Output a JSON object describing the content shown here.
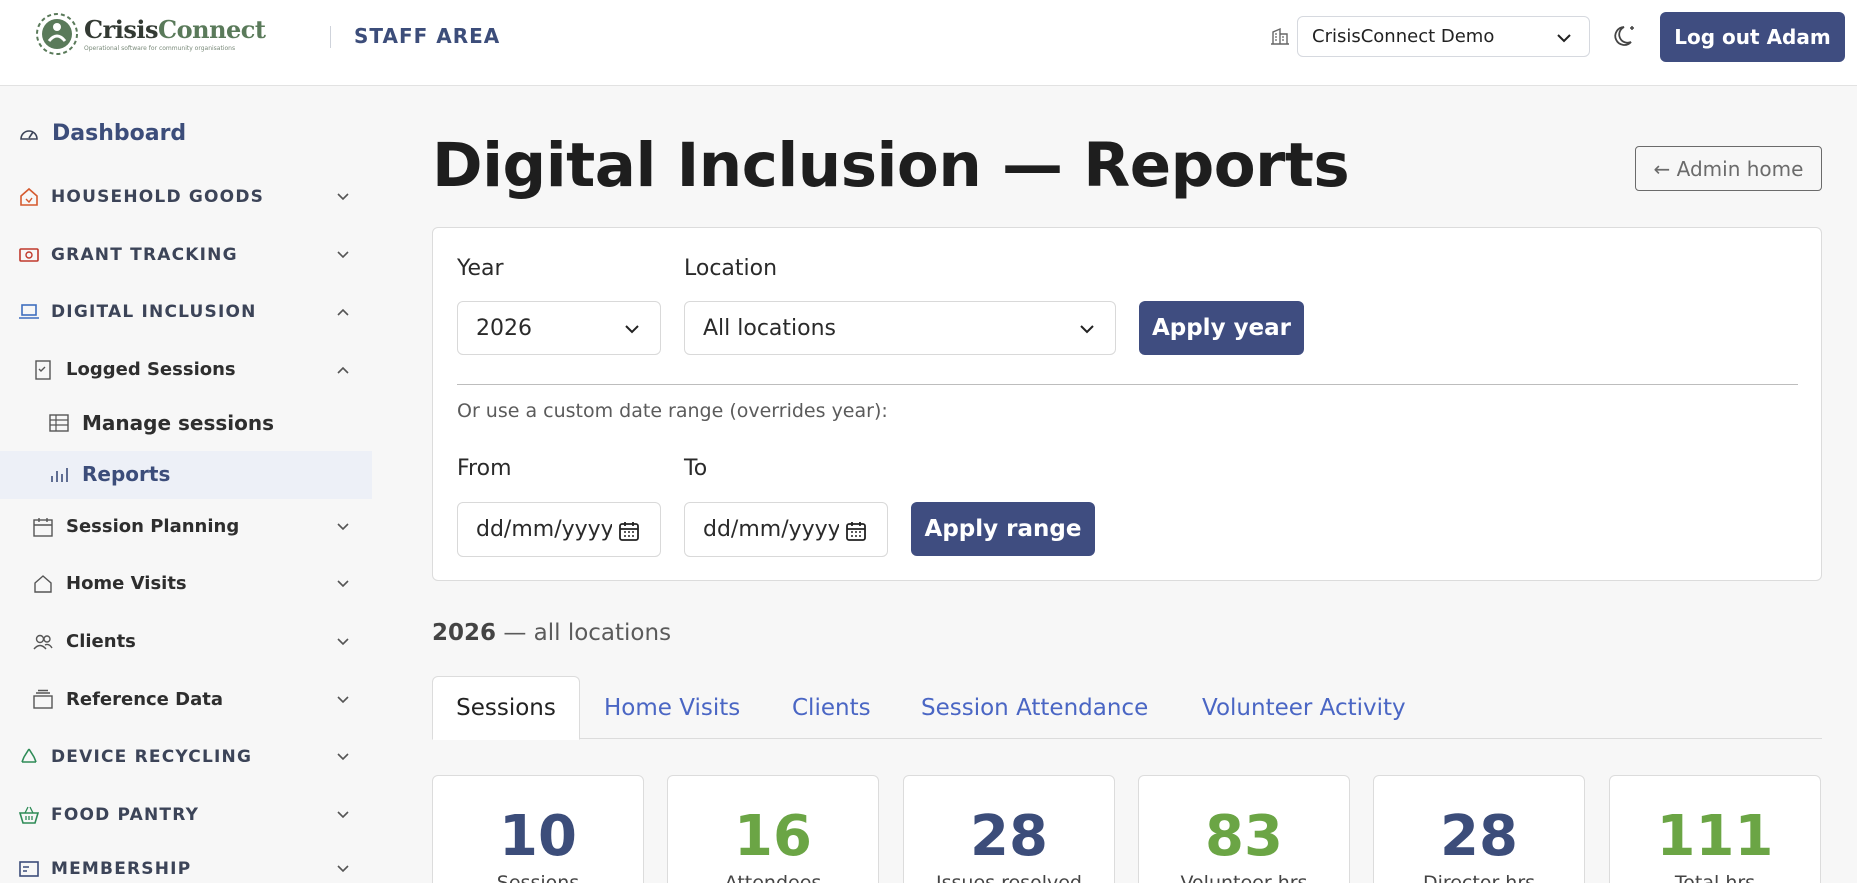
{
  "header": {
    "logo_name_a": "Crisis",
    "logo_name_b": "Connect",
    "logo_tagline": "Operational software for community organisations",
    "area_label": "STAFF AREA",
    "org_selected": "CrisisConnect Demo",
    "logout_label": "Log out Adam"
  },
  "sidebar": {
    "dashboard": "Dashboard",
    "household_goods": "HOUSEHOLD GOODS",
    "grant_tracking": "GRANT TRACKING",
    "digital_inclusion": "DIGITAL INCLUSION",
    "logged_sessions": "Logged Sessions",
    "manage_sessions": "Manage sessions",
    "reports": "Reports",
    "session_planning": "Session Planning",
    "home_visits": "Home Visits",
    "clients": "Clients",
    "reference_data": "Reference Data",
    "device_recycling": "DEVICE RECYCLING",
    "food_pantry": "FOOD PANTRY",
    "membership": "MEMBERSHIP"
  },
  "main": {
    "title": "Digital Inclusion — Reports",
    "admin_home": "← Admin home",
    "filters": {
      "year_label": "Year",
      "year_value": "2026",
      "location_label": "Location",
      "location_value": "All locations",
      "apply_year": "Apply year",
      "custom_hint": "Or use a custom date range (overrides year):",
      "from_label": "From",
      "to_label": "To",
      "date_placeholder": "dd/mm/yyyy",
      "apply_range": "Apply range"
    },
    "period_year": "2026",
    "period_rest": " — all locations",
    "tabs": [
      "Sessions",
      "Home Visits",
      "Clients",
      "Session Attendance",
      "Volunteer Activity"
    ],
    "stats": [
      {
        "value": "10",
        "label": "Sessions",
        "color": "#3c4d7a"
      },
      {
        "value": "16",
        "label": "Attendees",
        "color": "#6ba545"
      },
      {
        "value": "28",
        "label": "Issues resolved",
        "color": "#3c4d7a"
      },
      {
        "value": "83",
        "label": "Volunteer hrs",
        "color": "#6ba545"
      },
      {
        "value": "28",
        "label": "Director hrs",
        "color": "#3c4d7a"
      },
      {
        "value": "111",
        "label": "Total hrs",
        "color": "#6ba545"
      }
    ]
  },
  "colors": {
    "primary": "#3f4d80",
    "accent_green": "#6ba545",
    "link_blue": "#4a66c4"
  }
}
